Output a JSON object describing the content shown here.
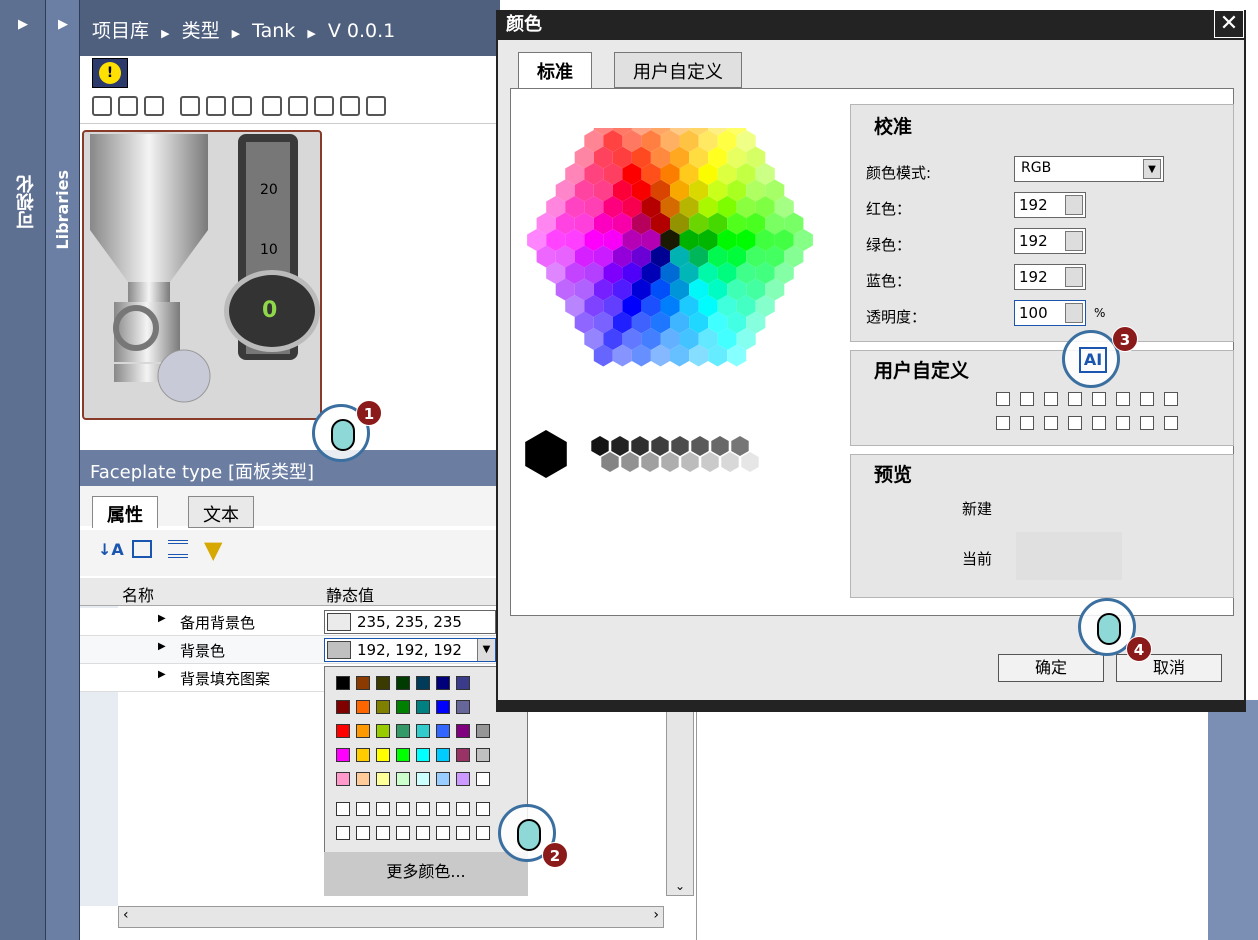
{
  "side": {
    "visualization_label": "可视化",
    "libraries_label": "Libraries"
  },
  "breadcrumb": [
    "项目库",
    "类型",
    "Tank",
    "V 0.0.1"
  ],
  "breadcrumb_sep": "▶",
  "faceplate": {
    "gauge_ticks": [
      "20",
      "10"
    ],
    "gauge_value": "0"
  },
  "properties": {
    "header": "Faceplate type [面板类型]",
    "tabs": [
      "属性",
      "文本"
    ],
    "col_name": "名称",
    "col_value": "静态值",
    "rows": [
      {
        "name": "备用背景色",
        "value": "235, 235, 235",
        "color": "#ebebeb"
      },
      {
        "name": "背景色",
        "value": "192, 192, 192",
        "color": "#c0c0c0"
      },
      {
        "name": "背景填充图案",
        "value": "",
        "color": ""
      }
    ]
  },
  "palette": {
    "colors": [
      [
        "#000000",
        "#8b3a00",
        "#3b3b00",
        "#003b00",
        "#003b5a",
        "#00007a",
        "#3b3b8b"
      ],
      [
        "#800000",
        "#ff6600",
        "#808000",
        "#008000",
        "#008080",
        "#0000ff",
        "#666699"
      ],
      [
        "#ff0000",
        "#ff9900",
        "#99cc00",
        "#339966",
        "#33cccc",
        "#3366ff",
        "#800080",
        "#969696"
      ],
      [
        "#ff00ff",
        "#ffcc00",
        "#ffff00",
        "#00ff00",
        "#00ffff",
        "#00ccff",
        "#993366",
        "#c0c0c0"
      ],
      [
        "#ff99cc",
        "#ffcc99",
        "#ffff99",
        "#ccffcc",
        "#ccffff",
        "#99ccff",
        "#cc99ff",
        "#ffffff"
      ]
    ],
    "more_colors": "更多颜色..."
  },
  "dialog": {
    "title": "颜色",
    "close": "✕",
    "tabs": [
      "标准",
      "用户自定义"
    ],
    "calibration": {
      "title": "校准",
      "mode_label": "颜色模式:",
      "mode_value": "RGB",
      "red_label": "红色：",
      "red_value": "192",
      "green_label": "绿色：",
      "green_value": "192",
      "blue_label": "蓝色：",
      "blue_value": "192",
      "alpha_label": "透明度：",
      "alpha_value": "100",
      "alpha_unit": "%"
    },
    "custom": {
      "title": "用户自定义"
    },
    "preview": {
      "title": "预览",
      "new_label": "新建",
      "current_label": "当前",
      "current_color": "#e6e6e6"
    },
    "ok": "确定",
    "cancel": "取消"
  },
  "callouts": [
    "1",
    "2",
    "3",
    "4"
  ],
  "ai_icon_text": "AI"
}
